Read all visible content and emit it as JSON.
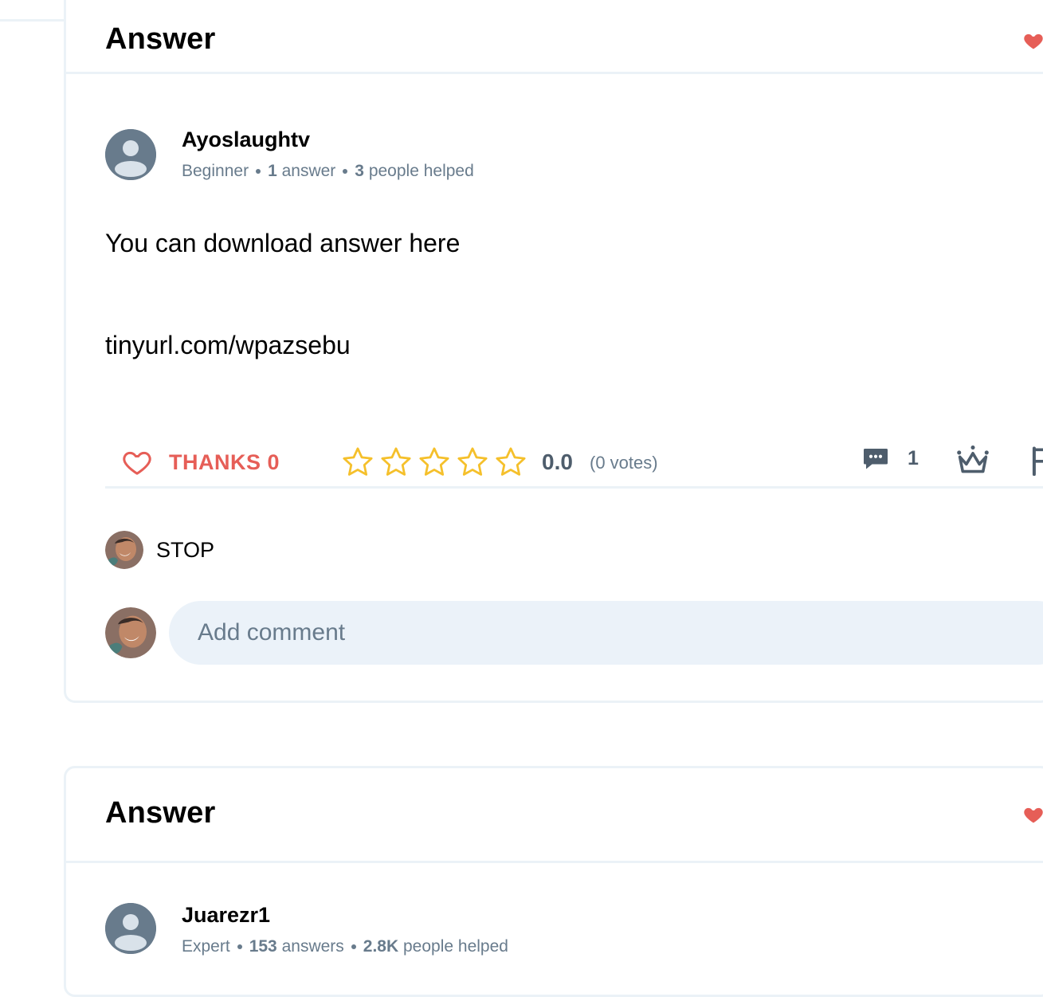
{
  "colors": {
    "accent_red": "#e65e57",
    "star_yellow": "#f5c02b",
    "muted_gray": "#687b8c",
    "border": "#ebf2f7",
    "input_bg": "#ebf2f9"
  },
  "answers": [
    {
      "title": "Answer",
      "author": {
        "name": "Ayoslaughtv",
        "rank": "Beginner",
        "answers_count": "1",
        "answers_label": "answer",
        "helped_count": "3",
        "helped_label": "people helped"
      },
      "body_lines": [
        "You can download answer here",
        "tinyurl.com/wpazsebu"
      ],
      "actions": {
        "thanks_label": "THANKS 0",
        "rating_value": "0.0",
        "votes_label": "(0 votes)",
        "stars_filled": 0,
        "stars_total": 5,
        "comment_count": "1",
        "icons": [
          "heart-outline-icon",
          "star-outline-icon",
          "comment-icon",
          "crown-icon",
          "flag-icon"
        ]
      },
      "comments": [
        {
          "text": "STOP"
        }
      ],
      "add_comment_placeholder": "Add comment"
    },
    {
      "title": "Answer",
      "author": {
        "name": "Juarezr1",
        "rank": "Expert",
        "answers_count": "153",
        "answers_label": "answers",
        "helped_count": "2.8K",
        "helped_label": "people helped"
      }
    }
  ]
}
